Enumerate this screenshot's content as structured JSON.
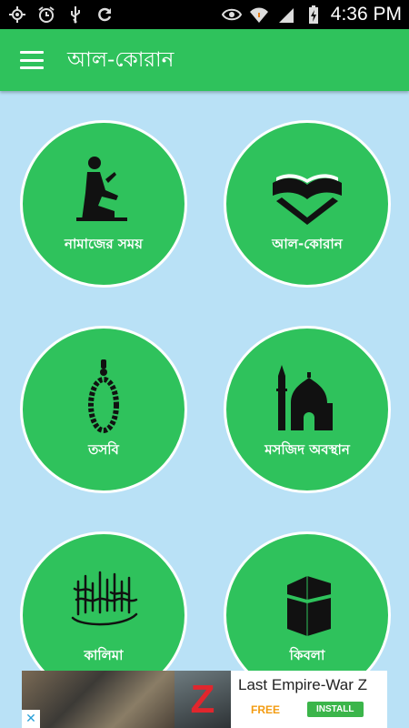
{
  "status_bar": {
    "time": "4:36 PM",
    "icons": [
      "gps-icon",
      "alarm-icon",
      "usb-icon",
      "sync-icon",
      "eye-icon",
      "wifi-icon",
      "signal-icon",
      "battery-charging-icon"
    ]
  },
  "app_bar": {
    "title": "আল-কোরান",
    "menu_icon": "hamburger-icon"
  },
  "tiles": [
    {
      "label": "নামাজের সময়",
      "icon": "prayer-icon"
    },
    {
      "label": "আল-কোরান",
      "icon": "quran-icon"
    },
    {
      "label": "তসবি",
      "icon": "tasbih-icon"
    },
    {
      "label": "মসজিদ অবস্থান",
      "icon": "mosque-icon"
    },
    {
      "label": "কালিমা",
      "icon": "kalima-icon"
    },
    {
      "label": "কিবলা",
      "icon": "kaaba-icon"
    }
  ],
  "ad": {
    "title": "Last Empire-War Z",
    "price": "FREE",
    "button": "INSTALL"
  },
  "colors": {
    "primary": "#2fc25c",
    "background": "#b9e1f6",
    "status_bar": "#000000"
  }
}
